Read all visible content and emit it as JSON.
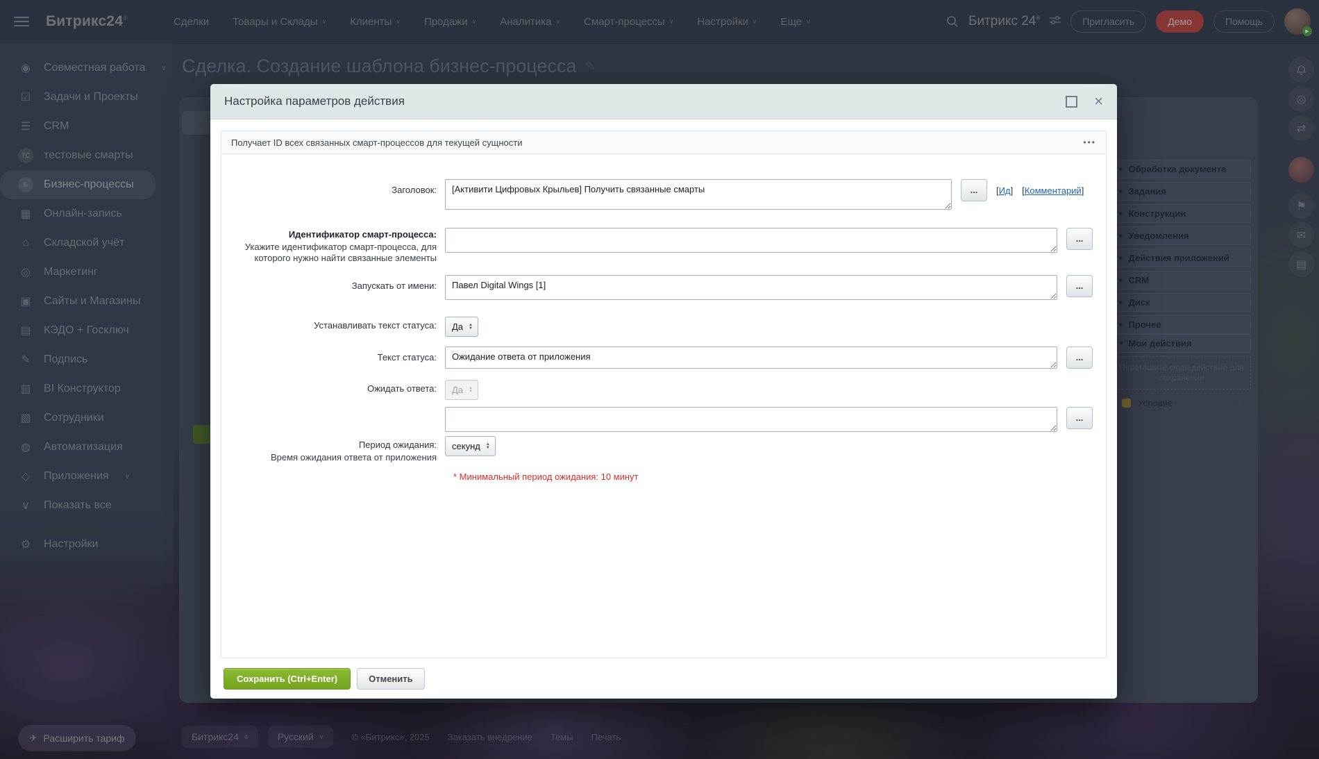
{
  "topbar": {
    "logo": "Битрикс24",
    "logo_reg": "®",
    "menu": [
      {
        "label": "Сделки"
      },
      {
        "label": "Товары и Склады"
      },
      {
        "label": "Клиенты"
      },
      {
        "label": "Продажи"
      },
      {
        "label": "Аналитика"
      },
      {
        "label": "Смарт-процессы"
      },
      {
        "label": "Настройки"
      },
      {
        "label": "Еще"
      }
    ],
    "search_brand": "Битрикс 24",
    "search_reg": "®",
    "invite_button": "Пригласить",
    "demo_button": "Демо",
    "help_button": "Помощь"
  },
  "sidebar": {
    "items": [
      {
        "label": "Совместная работа"
      },
      {
        "label": "Задачи и Проекты"
      },
      {
        "label": "CRM"
      },
      {
        "label": "тестовые смарты",
        "badge": "ТС"
      },
      {
        "label": "Бизнес-процессы",
        "badge": "Б"
      },
      {
        "label": "Онлайн-запись"
      },
      {
        "label": "Складской учёт"
      },
      {
        "label": "Маркетинг"
      },
      {
        "label": "Сайты и Магазины"
      },
      {
        "label": "КЭДО + Госключ"
      },
      {
        "label": "Подпись"
      },
      {
        "label": "BI Конструктор"
      },
      {
        "label": "Сотрудники"
      },
      {
        "label": "Автоматизация"
      },
      {
        "label": "Приложения"
      },
      {
        "label": "Показать все"
      },
      {
        "label": "Настройки"
      }
    ],
    "expand_tariff": "Расширить тариф"
  },
  "page": {
    "title": "Сделка. Создание шаблона бизнес-процесса"
  },
  "right_panel": {
    "categories": [
      "Обработка документа",
      "Задания",
      "Конструкции",
      "Уведомления",
      "Действия приложений",
      "CRM",
      "Диск",
      "Прочее"
    ],
    "my_actions": "Мои действия",
    "dropzone": "Перетащите сюда действие для сохранения",
    "condition": "Условие"
  },
  "modal": {
    "title": "Настройка параметров действия",
    "description": "Получает ID всех связанных смарт-процессов для текущей сущности",
    "menu_dots": "•••",
    "dots": "...",
    "fields": {
      "title_label": "Заголовок:",
      "title_value": "[Активити Цифровых Крыльев] Получить связанные смарты",
      "bracket_open": "[",
      "bracket_close": "]",
      "id_link": "Ид",
      "comment_link": "Комментарий",
      "smart_id_label": "Идентификатор смарт-процесса:",
      "smart_id_desc": "Укажите идентификатор смарт-процесса, для которого нужно найти связанные элементы",
      "run_as_label": "Запускать от имени:",
      "run_as_value": "Павел Digital Wings [1]",
      "set_status_label": "Устанавливать текст статуса:",
      "set_status_value": "Да",
      "status_text_label": "Текст статуса:",
      "status_text_value": "Ожидание ответа от приложения",
      "wait_answer_label": "Ожидать ответа:",
      "wait_answer_value": "Да",
      "wait_period_label": "Период ожидания:",
      "wait_period_desc": "Время ожидания ответа от приложения",
      "wait_period_value": "секунд",
      "warning": "* Минимальный период ожидания: 10 минут"
    },
    "save_button": "Сохранить (Ctrl+Enter)",
    "cancel_button": "Отменить"
  },
  "footer": {
    "brand": "Битрикс24",
    "brand_reg": "®",
    "language": "Русский",
    "copyright": "© «Битрикс», 2025",
    "order_link": "Заказать внедрение",
    "themes_link": "Темы",
    "print_link": "Печать"
  },
  "colors": {
    "accent_green": "#7ba629",
    "demo_red": "#a8403c",
    "link_blue": "#1e66b8",
    "warning_red": "#dd2b2b"
  }
}
